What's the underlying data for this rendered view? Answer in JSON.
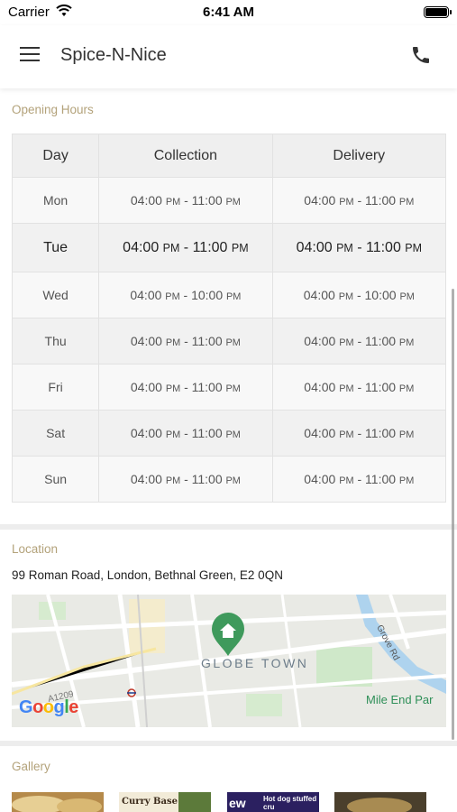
{
  "status_bar": {
    "carrier": "Carrier",
    "time": "6:41 AM"
  },
  "header": {
    "title": "Spice-N-Nice",
    "menu_icon": "hamburger-menu-icon",
    "phone_icon": "phone-icon"
  },
  "opening_hours": {
    "section_label": "Opening Hours",
    "columns": [
      "Day",
      "Collection",
      "Delivery"
    ],
    "rows": [
      {
        "day": "Mon",
        "collection": "04:00 PM - 11:00 PM",
        "delivery": "04:00 PM - 11:00 PM"
      },
      {
        "day": "Tue",
        "collection": "04:00 PM - 11:00 PM",
        "delivery": "04:00 PM - 11:00 PM"
      },
      {
        "day": "Wed",
        "collection": "04:00 PM - 10:00 PM",
        "delivery": "04:00 PM - 10:00 PM"
      },
      {
        "day": "Thu",
        "collection": "04:00 PM - 11:00 PM",
        "delivery": "04:00 PM - 11:00 PM"
      },
      {
        "day": "Fri",
        "collection": "04:00 PM - 11:00 PM",
        "delivery": "04:00 PM - 11:00 PM"
      },
      {
        "day": "Sat",
        "collection": "04:00 PM - 11:00 PM",
        "delivery": "04:00 PM - 11:00 PM"
      },
      {
        "day": "Sun",
        "collection": "04:00 PM - 11:00 PM",
        "delivery": "04:00 PM - 11:00 PM"
      }
    ]
  },
  "location": {
    "section_label": "Location",
    "address": "99 Roman Road, London, Bethnal Green, E2 0QN",
    "map": {
      "area_label": "GLOBE TOWN",
      "place_label": "Mile End Par",
      "street_label": "Grove Rd",
      "road_label": "A1209",
      "attribution": "Google",
      "pin_icon": "home-pin-icon"
    }
  },
  "gallery": {
    "section_label": "Gallery",
    "thumb_texts": [
      "Curry Base Pizzas",
      "Hot dog stuffed cru",
      "ew"
    ]
  },
  "colors": {
    "accent_label": "#b3a27a",
    "pin_green": "#3f9a5c"
  }
}
